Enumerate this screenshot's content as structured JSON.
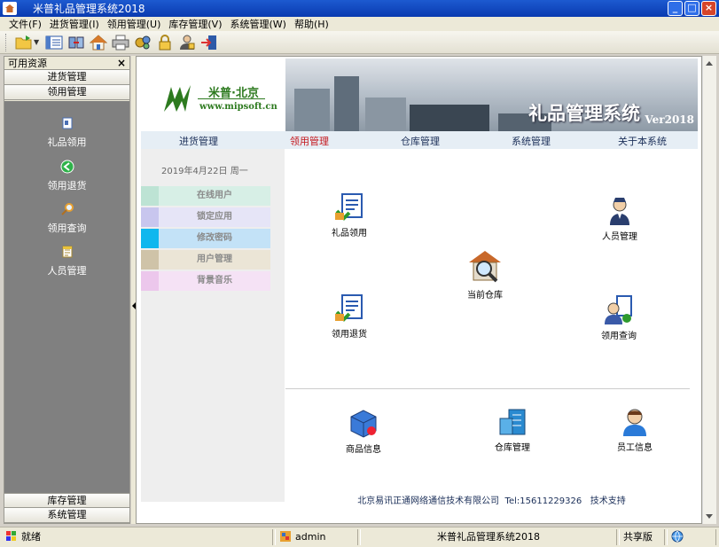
{
  "window": {
    "title": "米普礼品管理系统2018",
    "buttons": {
      "minimize": "_",
      "maximize": "□",
      "close": "×"
    }
  },
  "menu": [
    "文件(F)",
    "进货管理(I)",
    "领用管理(U)",
    "库存管理(V)",
    "系统管理(W)",
    "帮助(H)"
  ],
  "toolbar": {
    "icons": [
      "open-folder-icon",
      "list-icon",
      "transfer-icon",
      "home-icon",
      "print-icon",
      "settings-icon",
      "lock-icon",
      "user-lock-icon",
      "exit-icon"
    ]
  },
  "left_panel": {
    "header": "可用资源",
    "close": "×",
    "groups_top": [
      "进货管理",
      "领用管理"
    ],
    "items": [
      {
        "label": "礼品领用",
        "icon": "gift-issue-icon"
      },
      {
        "label": "领用退货",
        "icon": "return-icon"
      },
      {
        "label": "领用查询",
        "icon": "search-icon"
      },
      {
        "label": "人员管理",
        "icon": "staff-doc-icon"
      }
    ],
    "groups_bottom": [
      "库存管理",
      "系统管理"
    ]
  },
  "banner": {
    "logo_cn": "米普·北京",
    "logo_url": "www.mipsoft.cn",
    "title": "礼品管理系统",
    "version": "Ver2018"
  },
  "nav": [
    {
      "label": "进货管理",
      "active": false
    },
    {
      "label": "领用管理",
      "active": true
    },
    {
      "label": "仓库管理",
      "active": false
    },
    {
      "label": "系统管理",
      "active": false
    },
    {
      "label": "关于本系统",
      "active": false
    }
  ],
  "sidebar": {
    "date": "2019年4月22日  周一",
    "buttons": [
      {
        "label": "在线用户",
        "mark": "#bde3d4",
        "bg": "#d7efe6"
      },
      {
        "label": "锁定应用",
        "mark": "#c8c6ee",
        "bg": "#e6e5f7"
      },
      {
        "label": "修改密码",
        "mark": "#10b7ee",
        "bg": "#c3e2f7"
      },
      {
        "label": "用户管理",
        "mark": "#cfc3a8",
        "bg": "#ebe5d6"
      },
      {
        "label": "背景音乐",
        "mark": "#ecc7ec",
        "bg": "#f5e2f5"
      }
    ]
  },
  "tiles": {
    "gift_issue": "礼品领用",
    "staff": "人员管理",
    "warehouse_current": "当前仓库",
    "return": "领用退货",
    "query": "领用查询",
    "goods": "商品信息",
    "warehouse_mgmt": "仓库管理",
    "employee": "员工信息"
  },
  "footer": {
    "company": "北京易讯正通网络通信技术有限公司",
    "tel": "Tel:15611229326",
    "support": "技术支持"
  },
  "status": {
    "state": "就绪",
    "user": "admin",
    "app": "米普礼品管理系统2018",
    "edition": "共享版"
  }
}
